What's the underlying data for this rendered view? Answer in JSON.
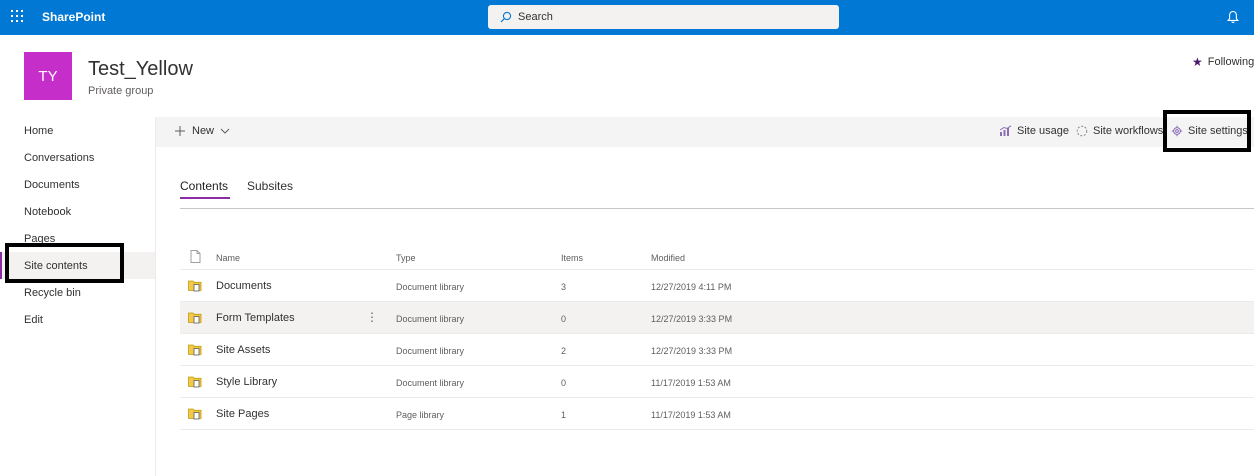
{
  "suite": {
    "brand": "SharePoint",
    "search_placeholder": "Search",
    "icons": {
      "waffle": "app-launcher-icon",
      "search": "search-icon",
      "bell": "bell-icon"
    }
  },
  "site": {
    "initials": "TY",
    "title": "Test_Yellow",
    "subtitle": "Private group",
    "following_label": "Following",
    "logo_color": "#c62ec9"
  },
  "nav": {
    "items": [
      {
        "label": "Home"
      },
      {
        "label": "Conversations"
      },
      {
        "label": "Documents"
      },
      {
        "label": "Notebook"
      },
      {
        "label": "Pages"
      },
      {
        "label": "Site contents",
        "selected": true
      },
      {
        "label": "Recycle bin"
      },
      {
        "label": "Edit"
      }
    ]
  },
  "commandbar": {
    "new_label": "New",
    "site_usage": "Site usage",
    "site_workflows": "Site workflows",
    "site_settings": "Site settings"
  },
  "pivots": {
    "contents": "Contents",
    "subsites": "Subsites",
    "selected": "Contents"
  },
  "table": {
    "headers": {
      "name": "Name",
      "type": "Type",
      "items": "Items",
      "modified": "Modified"
    },
    "rows": [
      {
        "name": "Documents",
        "type": "Document library",
        "items": "3",
        "modified": "12/27/2019 4:11 PM"
      },
      {
        "name": "Form Templates",
        "type": "Document library",
        "items": "0",
        "modified": "12/27/2019 3:33 PM",
        "hovered": true
      },
      {
        "name": "Site Assets",
        "type": "Document library",
        "items": "2",
        "modified": "12/27/2019 3:33 PM"
      },
      {
        "name": "Style Library",
        "type": "Document library",
        "items": "0",
        "modified": "11/17/2019 1:53 AM"
      },
      {
        "name": "Site Pages",
        "type": "Page library",
        "items": "1",
        "modified": "11/17/2019 1:53 AM"
      }
    ],
    "more_glyph": "⋮"
  },
  "colors": {
    "suite_bar": "#0078d4",
    "accent": "#8a2da5",
    "library_icon": "#c19c00"
  }
}
